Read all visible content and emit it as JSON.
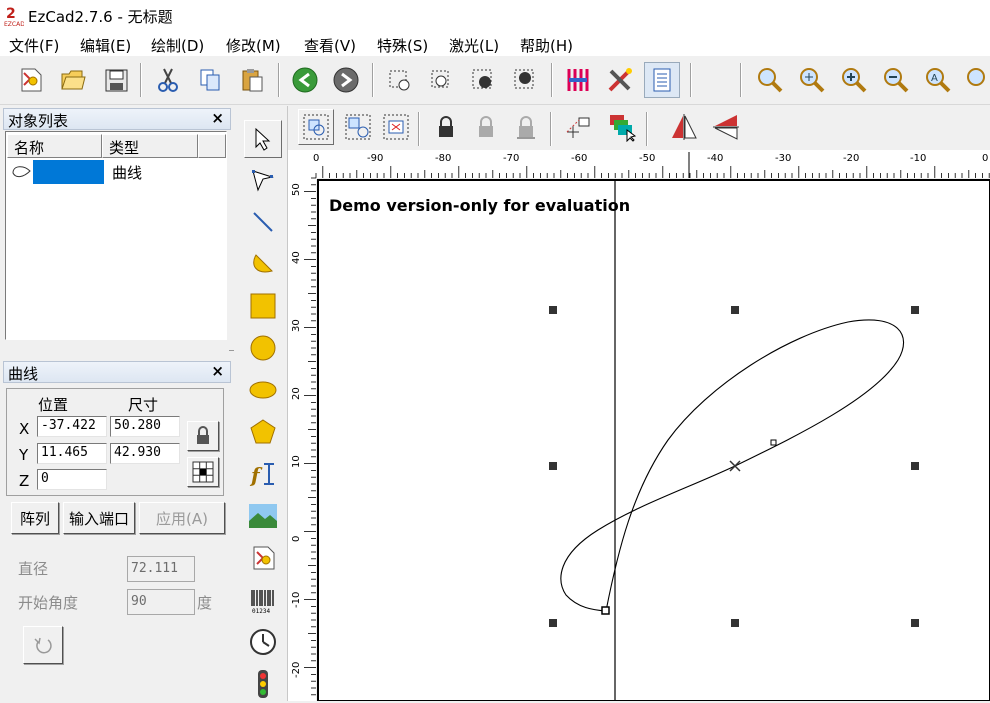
{
  "window": {
    "title": "EzCad2.7.6 - 无标题"
  },
  "menu": [
    "文件(F)",
    "编辑(E)",
    "绘制(D)",
    "修改(M)",
    "查看(V)",
    "特殊(S)",
    "激光(L)",
    "帮助(H)"
  ],
  "toolbar": {
    "icons": [
      "new-file-icon",
      "open-folder-icon",
      "save-icon",
      "cut-icon",
      "copy-icon",
      "paste-icon",
      "back-icon",
      "forward-icon",
      "node-select-icon",
      "node-edit-icon",
      "combine-icon",
      "break-icon",
      "hatch-icon",
      "tools-icon",
      "param-list-icon",
      "zoom-icon",
      "zoom-all-icon",
      "zoom-in-icon",
      "zoom-out-icon",
      "zoom-select-icon",
      "zoom-fit-icon"
    ]
  },
  "object_list": {
    "title": "对象列表",
    "columns": [
      "名称",
      "类型"
    ],
    "rows": [
      {
        "name": "",
        "type": "曲线"
      }
    ]
  },
  "properties": {
    "title": "曲线",
    "position_label": "位置",
    "size_label": "尺寸",
    "x_label": "X",
    "y_label": "Y",
    "z_label": "Z",
    "x_value": "-37.422",
    "y_value": "11.465",
    "z_value": "0",
    "width_value": "50.280",
    "height_value": "42.930",
    "array_btn": "阵列",
    "input_port_btn": "输入端口",
    "apply_btn": "应用(A)",
    "diameter_label": "直径",
    "diameter_value": "72.111",
    "start_angle_label": "开始角度",
    "start_angle_value": "90",
    "degree_label": "度"
  },
  "canvas": {
    "watermark": "Demo version-only for evaluation",
    "h_ticks": [
      "0",
      "-90",
      "-80",
      "-70",
      "-60",
      "-50",
      "-40",
      "-30",
      "-20",
      "-10",
      "0"
    ],
    "v_ticks": [
      "50",
      "40",
      "30",
      "20",
      "10",
      "0",
      "-10",
      "-20"
    ]
  }
}
